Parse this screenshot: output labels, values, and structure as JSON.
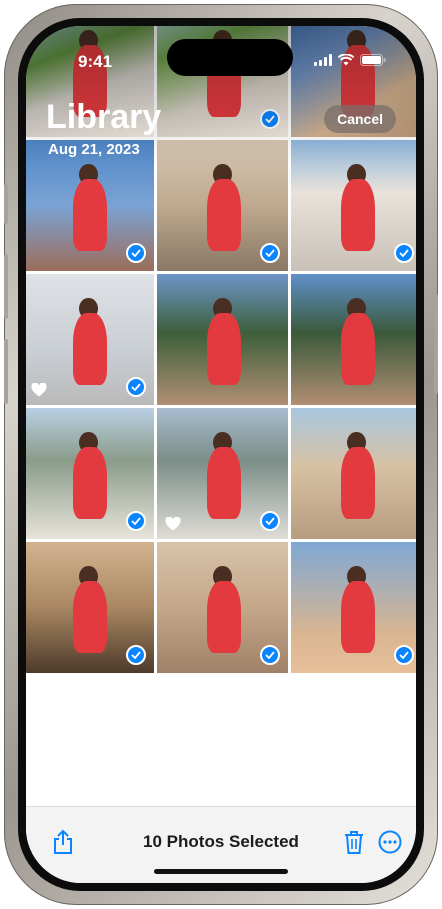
{
  "status": {
    "time": "9:41"
  },
  "header": {
    "title": "Library",
    "date": "Aug 21, 2023",
    "cancel_label": "Cancel"
  },
  "toolbar": {
    "selection_text": "10 Photos Selected",
    "share_icon": "share-icon",
    "trash_icon": "trash-icon",
    "more_icon": "more-icon"
  },
  "colors": {
    "accent": "#0a84ff",
    "toolbar_bg": "#f3f3f3"
  },
  "photos": [
    {
      "selected": false,
      "favorite": false
    },
    {
      "selected": true,
      "favorite": false
    },
    {
      "selected": false,
      "favorite": false
    },
    {
      "selected": true,
      "favorite": false
    },
    {
      "selected": true,
      "favorite": false
    },
    {
      "selected": true,
      "favorite": false
    },
    {
      "selected": true,
      "favorite": true
    },
    {
      "selected": false,
      "favorite": false
    },
    {
      "selected": false,
      "favorite": false
    },
    {
      "selected": true,
      "favorite": false
    },
    {
      "selected": true,
      "favorite": true
    },
    {
      "selected": false,
      "favorite": false
    },
    {
      "selected": true,
      "favorite": false
    },
    {
      "selected": true,
      "favorite": false
    },
    {
      "selected": true,
      "favorite": false
    }
  ]
}
